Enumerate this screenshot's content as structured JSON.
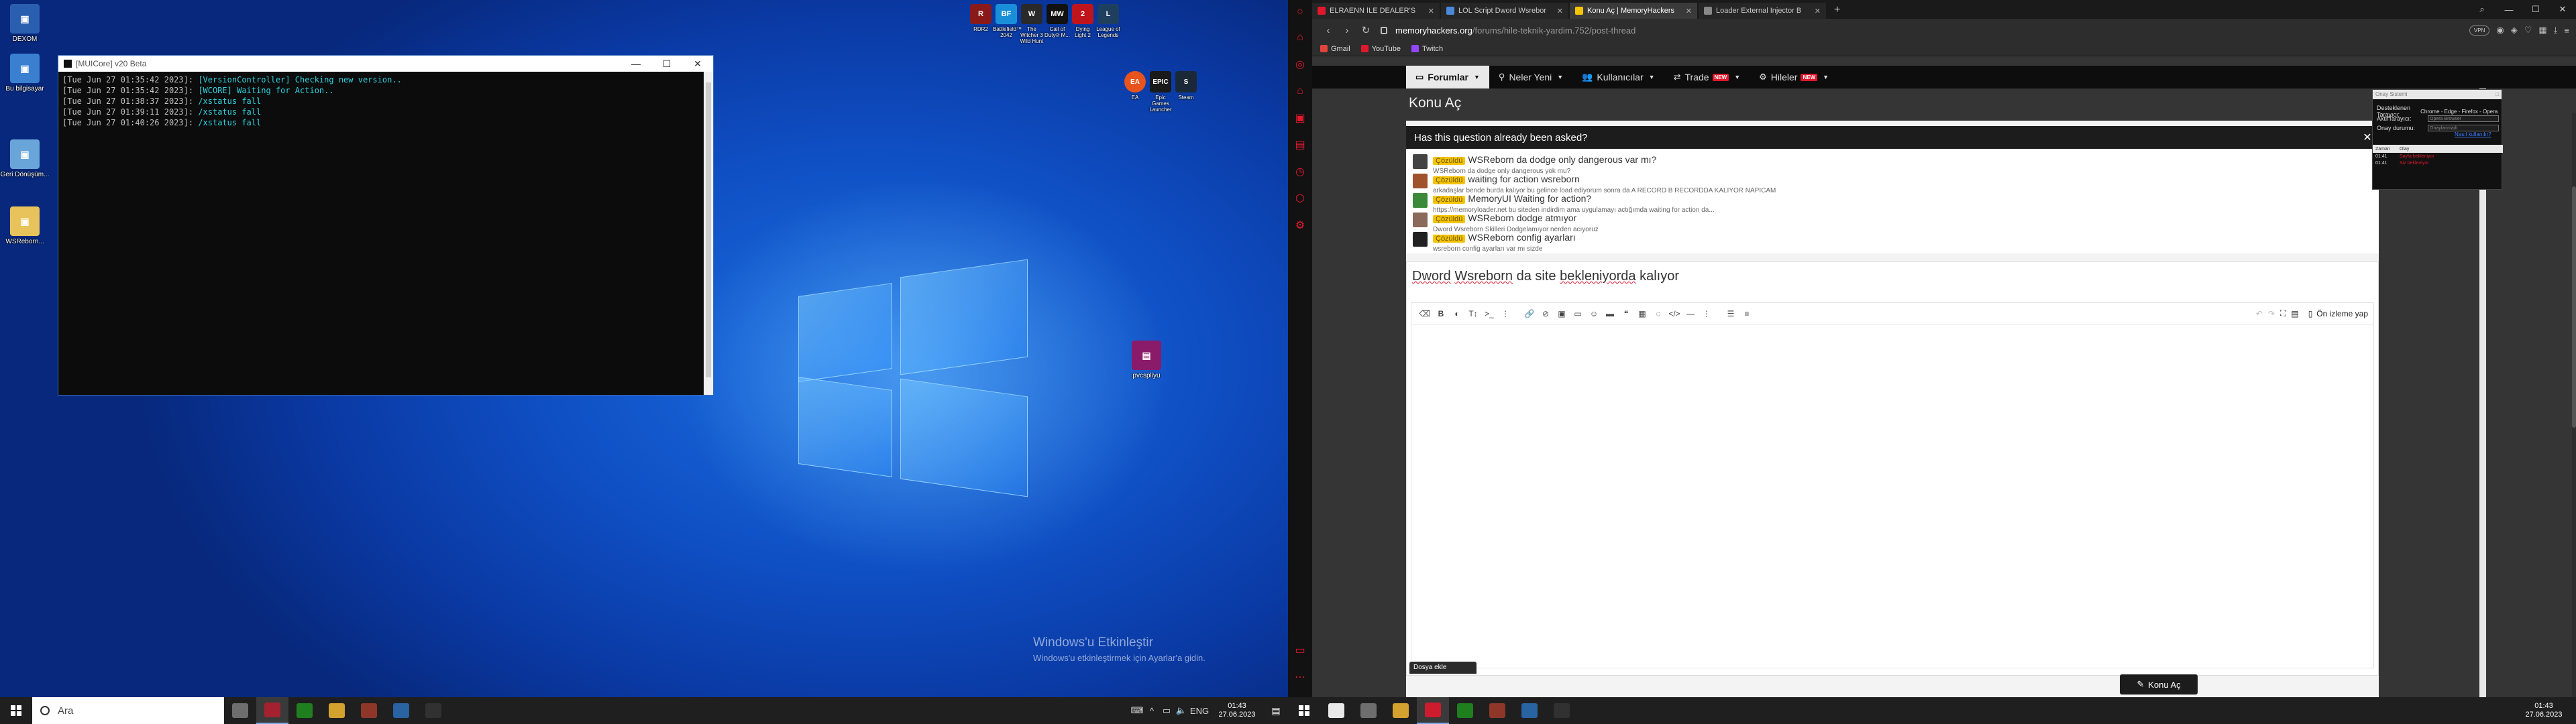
{
  "left_desktop": {
    "icons": [
      {
        "label": "DEXOM",
        "color": "#2a5fb0"
      },
      {
        "label": "Bu bilgisayar",
        "color": "#3a7fd0"
      },
      {
        "label": "Geri Dönüşüm...",
        "color": "#6aa5d9"
      },
      {
        "label": "WSReborn...",
        "color": "#e8c25a"
      }
    ],
    "top_icons": [
      {
        "label": "RDR2",
        "short": "R",
        "color": "#8a1a1a"
      },
      {
        "label": "Battlefield™ 2042",
        "short": "BF",
        "color": "#1a8fd9"
      },
      {
        "label": "The Witcher 3 Wild Hunt",
        "short": "W",
        "color": "#2a2a2a"
      },
      {
        "label": "Call of Duty® M...",
        "short": "MW",
        "color": "#111111"
      },
      {
        "label": "Dying Light 2",
        "short": "2",
        "color": "#c0141c"
      },
      {
        "label": "League of Legends",
        "short": "L",
        "color": "#1f3f5f"
      }
    ],
    "row2_icons": [
      {
        "label": "EA",
        "short": "EA",
        "color": "#e8541c"
      },
      {
        "label": "Epic Games Launcher",
        "short": "EPIC",
        "color": "#1a1a1a"
      },
      {
        "label": "Steam",
        "short": "S",
        "color": "#1b2838"
      }
    ],
    "archive_icon": {
      "label": "pvcspliyu",
      "color": "#8a1a6a"
    },
    "watermark": {
      "title": "Windows'u Etkinleştir",
      "subtitle": "Windows'u etkinleştirmek için Ayarlar'a gidin."
    }
  },
  "console_window": {
    "title": "[MUICore] v20 Beta",
    "controls": {
      "minimize": "—",
      "maximize": "☐",
      "close": "✕"
    },
    "lines": [
      {
        "time": "[Tue Jun 27 01:35:42 2023]:",
        "msg": "[VersionController] Checking new version.."
      },
      {
        "time": "[Tue Jun 27 01:35:42 2023]:",
        "msg": "[WCORE] Waiting for Action.."
      },
      {
        "time": "[Tue Jun 27 01:38:37 2023]:",
        "msg": "/xstatus fall"
      },
      {
        "time": "[Tue Jun 27 01:39:11 2023]:",
        "msg": "/xstatus fall"
      },
      {
        "time": "[Tue Jun 27 01:40:26 2023]:",
        "msg": "/xstatus fall"
      }
    ]
  },
  "taskbar_left": {
    "search_placeholder": "Ara",
    "apps": [
      {
        "name": "task-view",
        "color": "#777777"
      },
      {
        "name": "app-red",
        "color": "#b02030"
      },
      {
        "name": "xbox",
        "color": "#1f8a1f"
      },
      {
        "name": "explorer",
        "color": "#e8b030"
      },
      {
        "name": "game",
        "color": "#9a3a2a"
      },
      {
        "name": "ide",
        "color": "#2a6ab0"
      },
      {
        "name": "console",
        "color": "#333333"
      }
    ],
    "clock": {
      "time": "01:43",
      "date": "27.06.2023"
    },
    "lang": "ENG"
  },
  "browser": {
    "tabs": [
      {
        "title": "ELRAENN İLE DEALER'S",
        "fav": "#e0182d",
        "active": false
      },
      {
        "title": "LOL Script Dword Wsrebor",
        "fav": "#4a8adb",
        "active": false
      },
      {
        "title": "Konu Aç | MemoryHackers",
        "fav": "#f5c400",
        "active": true
      },
      {
        "title": "Loader External Injector B",
        "fav": "#888888",
        "active": false
      }
    ],
    "new_tab": "+",
    "win_controls": {
      "minimize": "—",
      "maximize": "☐",
      "close": "✕"
    },
    "url": {
      "domain": "memoryhackers.org",
      "path": "/forums/hile-teknik-yardim.752/post-thread"
    },
    "vpn": "VPN",
    "bookmarks": [
      {
        "label": "Gmail",
        "color": "#e0443c"
      },
      {
        "label": "YouTube",
        "color": "#e0182d"
      },
      {
        "label": "Twitch",
        "color": "#9146ff"
      }
    ]
  },
  "site": {
    "nav": [
      {
        "label": "Forumlar",
        "icon": "▭",
        "active": true,
        "new": false
      },
      {
        "label": "Neler Yeni",
        "icon": "⚲",
        "active": false,
        "new": false
      },
      {
        "label": "Kullanıcılar",
        "icon": "👥",
        "active": false,
        "new": false
      },
      {
        "label": "Trade",
        "icon": "⇄",
        "active": false,
        "new": true
      },
      {
        "label": "Hileler",
        "icon": "⚙",
        "active": false,
        "new": true
      }
    ],
    "new_badge": "NEW",
    "page_title": "Konu Aç",
    "question_box": {
      "title": "Has this question already been asked?",
      "close": "✕",
      "items": [
        {
          "badge": "Çözüldü",
          "title": "WSReborn da dodge only dangerous var mı?",
          "sub": "WSReborn da dodge only dangerous yok mu?",
          "av": "#444444"
        },
        {
          "badge": "Çözüldü",
          "title": "waiting for action wsreborn",
          "sub": "arkadaşlar bende burda kalıyor bu gelince load ediyorum sonra da A RECORD B RECORDDA KALIYOR NAPICAM",
          "av": "#a0522d"
        },
        {
          "badge": "Çözüldü",
          "title": "MemoryUI Waiting for action?",
          "sub": "https://memoryloader.net bu siteden indirdim ama uygulamayı actığımda waiting for action da...",
          "av": "#3a8a3a"
        },
        {
          "badge": "Çözüldü",
          "title": "WSReborn dodge atmıyor",
          "sub": "Dword Wsreborn Skilleri Dodgelamıyor nerden acıyoruz",
          "av": "#8a6a5a"
        },
        {
          "badge": "Çözüldü",
          "title": "WSReborn config ayarları",
          "sub": "wsreborn config ayarları var mı sizde",
          "av": "#222222"
        }
      ]
    },
    "subject_words": [
      "Dword",
      "Wsreborn",
      "da site",
      "bekleniyorda",
      "kalıyor"
    ],
    "preview_label": "Ön izleme yap",
    "attach_label": "Dosya ekle",
    "submit_label": "Konu Aç"
  },
  "tool_panel": {
    "title": "Onay Sistemi",
    "supported_label": "Desteklenen Tarayıcı:",
    "supported_value": "Chrome - Edge - Firefox - Opera - Coc",
    "active_label": "AktifTarayıcı:",
    "active_placeholder": "Opera Browser",
    "status_label": "Onay durumu:",
    "status_placeholder": "Onaylanmadı",
    "howto_link": "Nasıl kullanılır?",
    "log_head_time": "Zaman",
    "log_head_event": "Olay",
    "logs": [
      {
        "time": "01:41",
        "msg": "Sayfa bekleniyor"
      },
      {
        "time": "01:41",
        "msg": "Siz bekleniyor"
      }
    ]
  },
  "taskbar_right": {
    "apps": [
      {
        "name": "search",
        "color": "#ffffff"
      },
      {
        "name": "task-view",
        "color": "#777777"
      },
      {
        "name": "explorer",
        "color": "#e8b030"
      },
      {
        "name": "opera",
        "color": "#e0182d"
      },
      {
        "name": "xbox",
        "color": "#1f8a1f"
      },
      {
        "name": "game",
        "color": "#9a3a2a"
      },
      {
        "name": "ide",
        "color": "#2a6ab0"
      },
      {
        "name": "console",
        "color": "#333333"
      }
    ],
    "clock": {
      "time": "01:43",
      "date": "27.06.2023"
    }
  }
}
